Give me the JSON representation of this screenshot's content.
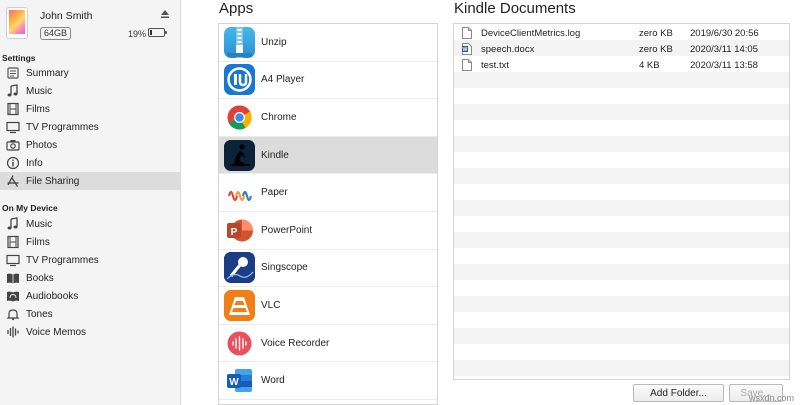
{
  "device": {
    "name": "John Smith",
    "capacity": "64GB",
    "battery_percent": "19%",
    "battery_level": 0.19
  },
  "sidebar": {
    "settings_title": "Settings",
    "settings_items": [
      {
        "label": "Summary",
        "icon": "summary-icon"
      },
      {
        "label": "Music",
        "icon": "music-note-icon"
      },
      {
        "label": "Films",
        "icon": "film-icon"
      },
      {
        "label": "TV Programmes",
        "icon": "tv-icon"
      },
      {
        "label": "Photos",
        "icon": "camera-icon"
      },
      {
        "label": "Info",
        "icon": "info-icon"
      },
      {
        "label": "File Sharing",
        "icon": "app-store-icon",
        "selected": true
      }
    ],
    "on_device_title": "On My Device",
    "device_items": [
      {
        "label": "Music",
        "icon": "music-note-icon"
      },
      {
        "label": "Films",
        "icon": "film-icon"
      },
      {
        "label": "TV Programmes",
        "icon": "tv-icon"
      },
      {
        "label": "Books",
        "icon": "book-icon"
      },
      {
        "label": "Audiobooks",
        "icon": "audiobook-icon"
      },
      {
        "label": "Tones",
        "icon": "bell-icon"
      },
      {
        "label": "Voice Memos",
        "icon": "voice-memo-icon"
      }
    ]
  },
  "apps": {
    "heading": "Apps",
    "items": [
      {
        "label": "Unzip",
        "icon": "unzip-app-icon"
      },
      {
        "label": "A4 Player",
        "icon": "a4-player-app-icon"
      },
      {
        "label": "Chrome",
        "icon": "chrome-app-icon"
      },
      {
        "label": "Kindle",
        "icon": "kindle-app-icon",
        "selected": true
      },
      {
        "label": "Paper",
        "icon": "paper-app-icon"
      },
      {
        "label": "PowerPoint",
        "icon": "powerpoint-app-icon"
      },
      {
        "label": "Singscope",
        "icon": "singscope-app-icon"
      },
      {
        "label": "VLC",
        "icon": "vlc-app-icon"
      },
      {
        "label": "Voice Recorder",
        "icon": "voice-recorder-app-icon"
      },
      {
        "label": "Word",
        "icon": "word-app-icon"
      }
    ]
  },
  "documents": {
    "heading": "Kindle Documents",
    "files": [
      {
        "name": "DeviceClientMetrics.log",
        "size": "zero KB",
        "date": "2019/6/30 20:56",
        "icon": "text-file-icon"
      },
      {
        "name": "speech.docx",
        "size": "zero KB",
        "date": "2020/3/11 14:05",
        "icon": "word-doc-icon"
      },
      {
        "name": "test.txt",
        "size": "4 KB",
        "date": "2020/3/11 13:58",
        "icon": "text-file-icon"
      }
    ],
    "add_folder_label": "Add Folder...",
    "save_label": "Save..."
  },
  "watermark": "wsxdn.com",
  "colors": {
    "selected_row": "#dcdcdc",
    "sidebar_bg": "#f4f4f4",
    "stripe": "#f3f3f3"
  }
}
